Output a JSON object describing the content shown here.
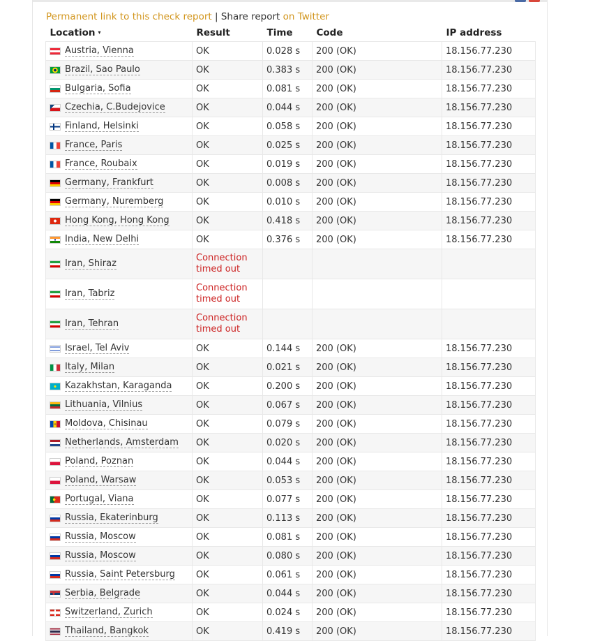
{
  "header": {
    "permalink_label": "Permanent link to this check report",
    "separator": "|",
    "share_label": "Share report",
    "on_twitter_label": "on Twitter"
  },
  "columns": {
    "location": "Location",
    "sort_indicator": "▾",
    "result": "Result",
    "time": "Time",
    "code": "Code",
    "ip": "IP address"
  },
  "rows": [
    {
      "location": "Austria, Vienna",
      "flag": "austria-flag-icon",
      "result": "OK",
      "time": "0.028 s",
      "code": "200 (OK)",
      "ip": "18.156.77.230"
    },
    {
      "location": "Brazil, Sao Paulo",
      "flag": "brazil-flag-icon",
      "result": "OK",
      "time": "0.383 s",
      "code": "200 (OK)",
      "ip": "18.156.77.230"
    },
    {
      "location": "Bulgaria, Sofia",
      "flag": "bulgaria-flag-icon",
      "result": "OK",
      "time": "0.081 s",
      "code": "200 (OK)",
      "ip": "18.156.77.230"
    },
    {
      "location": "Czechia, C.Budejovice",
      "flag": "czechia-flag-icon",
      "result": "OK",
      "time": "0.044 s",
      "code": "200 (OK)",
      "ip": "18.156.77.230"
    },
    {
      "location": "Finland, Helsinki",
      "flag": "finland-flag-icon",
      "result": "OK",
      "time": "0.058 s",
      "code": "200 (OK)",
      "ip": "18.156.77.230"
    },
    {
      "location": "France, Paris",
      "flag": "france-flag-icon",
      "result": "OK",
      "time": "0.025 s",
      "code": "200 (OK)",
      "ip": "18.156.77.230"
    },
    {
      "location": "France, Roubaix",
      "flag": "france-flag-icon",
      "result": "OK",
      "time": "0.019 s",
      "code": "200 (OK)",
      "ip": "18.156.77.230"
    },
    {
      "location": "Germany, Frankfurt",
      "flag": "germany-flag-icon",
      "result": "OK",
      "time": "0.008 s",
      "code": "200 (OK)",
      "ip": "18.156.77.230"
    },
    {
      "location": "Germany, Nuremberg",
      "flag": "germany-flag-icon",
      "result": "OK",
      "time": "0.010 s",
      "code": "200 (OK)",
      "ip": "18.156.77.230"
    },
    {
      "location": "Hong Kong, Hong Kong",
      "flag": "hong-kong-flag-icon",
      "result": "OK",
      "time": "0.418 s",
      "code": "200 (OK)",
      "ip": "18.156.77.230"
    },
    {
      "location": "India, New Delhi",
      "flag": "india-flag-icon",
      "result": "OK",
      "time": "0.376 s",
      "code": "200 (OK)",
      "ip": "18.156.77.230"
    },
    {
      "location": "Iran, Shiraz",
      "flag": "iran-flag-icon",
      "result": "Connection timed out",
      "time": "",
      "code": "",
      "ip": "",
      "error": true
    },
    {
      "location": "Iran, Tabriz",
      "flag": "iran-flag-icon",
      "result": "Connection timed out",
      "time": "",
      "code": "",
      "ip": "",
      "error": true
    },
    {
      "location": "Iran, Tehran",
      "flag": "iran-flag-icon",
      "result": "Connection timed out",
      "time": "",
      "code": "",
      "ip": "",
      "error": true
    },
    {
      "location": "Israel, Tel Aviv",
      "flag": "israel-flag-icon",
      "result": "OK",
      "time": "0.144 s",
      "code": "200 (OK)",
      "ip": "18.156.77.230"
    },
    {
      "location": "Italy, Milan",
      "flag": "italy-flag-icon",
      "result": "OK",
      "time": "0.021 s",
      "code": "200 (OK)",
      "ip": "18.156.77.230"
    },
    {
      "location": "Kazakhstan, Karaganda",
      "flag": "kazakhstan-flag-icon",
      "result": "OK",
      "time": "0.200 s",
      "code": "200 (OK)",
      "ip": "18.156.77.230"
    },
    {
      "location": "Lithuania, Vilnius",
      "flag": "lithuania-flag-icon",
      "result": "OK",
      "time": "0.067 s",
      "code": "200 (OK)",
      "ip": "18.156.77.230"
    },
    {
      "location": "Moldova, Chisinau",
      "flag": "moldova-flag-icon",
      "result": "OK",
      "time": "0.079 s",
      "code": "200 (OK)",
      "ip": "18.156.77.230"
    },
    {
      "location": "Netherlands, Amsterdam",
      "flag": "netherlands-flag-icon",
      "result": "OK",
      "time": "0.020 s",
      "code": "200 (OK)",
      "ip": "18.156.77.230"
    },
    {
      "location": "Poland, Poznan",
      "flag": "poland-flag-icon",
      "result": "OK",
      "time": "0.044 s",
      "code": "200 (OK)",
      "ip": "18.156.77.230"
    },
    {
      "location": "Poland, Warsaw",
      "flag": "poland-flag-icon",
      "result": "OK",
      "time": "0.053 s",
      "code": "200 (OK)",
      "ip": "18.156.77.230"
    },
    {
      "location": "Portugal, Viana",
      "flag": "portugal-flag-icon",
      "result": "OK",
      "time": "0.077 s",
      "code": "200 (OK)",
      "ip": "18.156.77.230"
    },
    {
      "location": "Russia, Ekaterinburg",
      "flag": "russia-flag-icon",
      "result": "OK",
      "time": "0.113 s",
      "code": "200 (OK)",
      "ip": "18.156.77.230"
    },
    {
      "location": "Russia, Moscow",
      "flag": "russia-flag-icon",
      "result": "OK",
      "time": "0.081 s",
      "code": "200 (OK)",
      "ip": "18.156.77.230"
    },
    {
      "location": "Russia, Moscow",
      "flag": "russia-flag-icon",
      "result": "OK",
      "time": "0.080 s",
      "code": "200 (OK)",
      "ip": "18.156.77.230"
    },
    {
      "location": "Russia, Saint Petersburg",
      "flag": "russia-flag-icon",
      "result": "OK",
      "time": "0.061 s",
      "code": "200 (OK)",
      "ip": "18.156.77.230"
    },
    {
      "location": "Serbia, Belgrade",
      "flag": "serbia-flag-icon",
      "result": "OK",
      "time": "0.044 s",
      "code": "200 (OK)",
      "ip": "18.156.77.230"
    },
    {
      "location": "Switzerland, Zurich",
      "flag": "switzerland-flag-icon",
      "result": "OK",
      "time": "0.024 s",
      "code": "200 (OK)",
      "ip": "18.156.77.230"
    },
    {
      "location": "Thailand, Bangkok",
      "flag": "thailand-flag-icon",
      "result": "OK",
      "time": "0.419 s",
      "code": "200 (OK)",
      "ip": "18.156.77.230"
    }
  ],
  "colors": {
    "link": "#d2961e",
    "error": "#cc2222",
    "row_alt": "#f6f6f6",
    "border": "#e8e8e8"
  }
}
